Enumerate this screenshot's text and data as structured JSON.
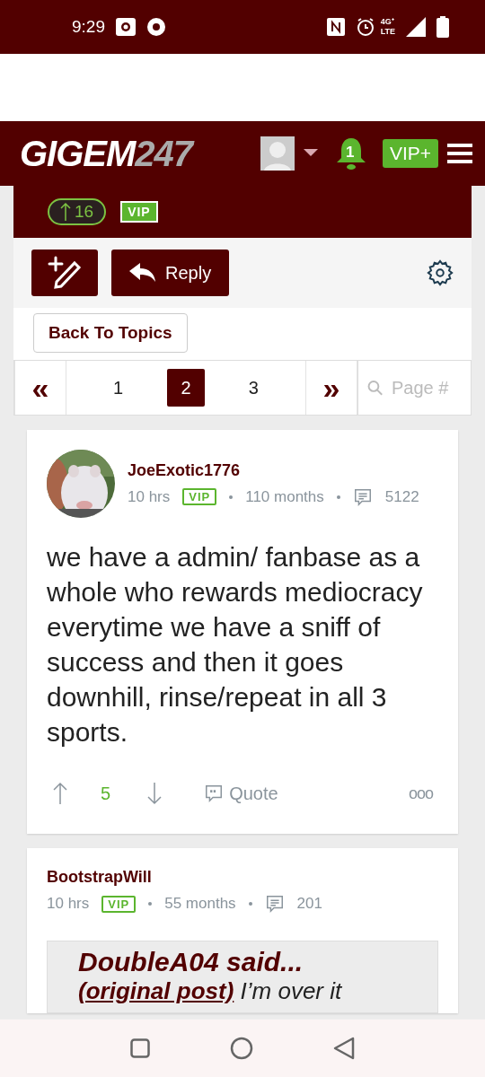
{
  "status_bar": {
    "time": "9:29",
    "network": "4G⁺\nLTE"
  },
  "header": {
    "logo_main": "GIGEM",
    "logo_accent": "247",
    "notifications": "1",
    "vip_button": "VIP+"
  },
  "thread_banner": {
    "upvotes": "16",
    "badge": "VIP"
  },
  "toolbar": {
    "reply": "Reply"
  },
  "back_button": "Back To Topics",
  "pagination": {
    "first": "«",
    "last": "»",
    "pages": [
      {
        "label": "1",
        "selected": false
      },
      {
        "label": "2",
        "selected": true
      },
      {
        "label": "3",
        "selected": false
      }
    ],
    "placeholder": "Page #"
  },
  "posts": [
    {
      "author": "JoeExotic1776",
      "has_avatar": true,
      "time": "10 hrs",
      "badge": "VIP",
      "tenure": "110 months",
      "post_count": "5122",
      "body": "we have a admin/ fanbase as a whole who rewards mediocracy everytime we have a sniff of success and then it goes downhill, rinse/repeat in all 3 sports.",
      "votes": "5",
      "quote_label": "Quote",
      "more": "ooo"
    },
    {
      "author": "BootstrapWill",
      "has_avatar": false,
      "time": "10 hrs",
      "badge": "VIP",
      "tenure": "55 months",
      "post_count": "201",
      "quote": {
        "author": "DoubleA04 said...",
        "link": "(original post)",
        "text": "I’m over it"
      }
    }
  ]
}
